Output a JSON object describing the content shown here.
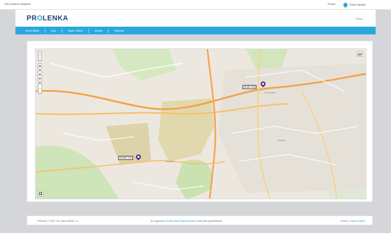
{
  "topbar": {
    "welcome": "Hoş Geldiniz Müşterim",
    "language": "Türkçe",
    "user_name": "Ömer Karanlı"
  },
  "header": {
    "logo_a": "PR",
    "logo_o": "O",
    "logo_b": "LENKA",
    "right_text": "Türkçe"
  },
  "nav": {
    "items": [
      "Genel Bakış",
      "Araç",
      "Rapor Listesi",
      "Araçlar",
      "Raporlar"
    ]
  },
  "map": {
    "markers": [
      {
        "label": "06 AB 1234"
      },
      {
        "label": "06 ABC 123"
      }
    ],
    "place_labels": [
      "Yenimahalle",
      "Batıkent",
      "Eryaman"
    ]
  },
  "footer": {
    "left": "Prolenka © 2016. Her hakkı saklıdır. v1",
    "mid_prefix": "Bu uygulama ",
    "mid_link": "Yenilikçi Mobil Bilgi Sistemleri",
    "mid_suffix": " tarafından geliştirilmiştir.",
    "right_prefix": "Destek: ",
    "right_link1": "Türkçe",
    "right_link2": "English"
  },
  "colors": {
    "nav_bg": "#29a8e0",
    "logo": "#1e3f77",
    "marker": "#54307a"
  }
}
